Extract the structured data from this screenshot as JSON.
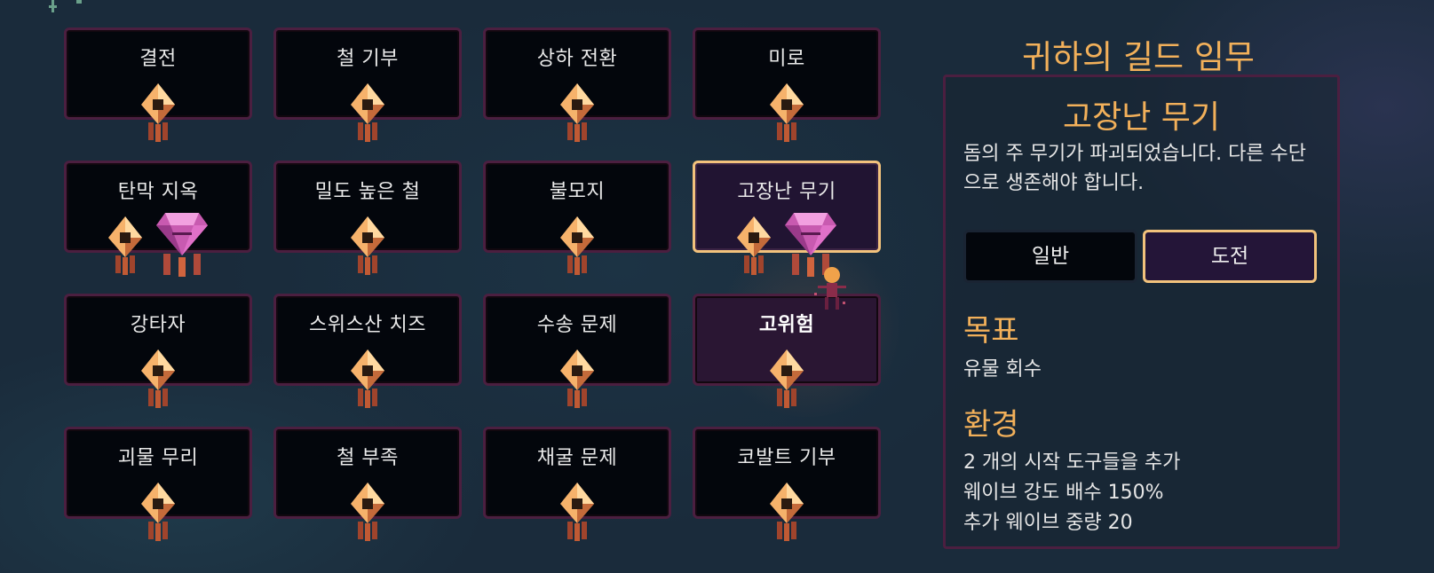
{
  "missions": [
    {
      "label": "결전",
      "gem": false
    },
    {
      "label": "철 기부",
      "gem": false
    },
    {
      "label": "상하 전환",
      "gem": false
    },
    {
      "label": "미로",
      "gem": false
    },
    {
      "label": "탄막 지옥",
      "gem": true
    },
    {
      "label": "밀도 높은 철",
      "gem": false
    },
    {
      "label": "불모지",
      "gem": false
    },
    {
      "label": "고장난 무기",
      "gem": true,
      "selected": true
    },
    {
      "label": "강타자",
      "gem": false
    },
    {
      "label": "스위스산 치즈",
      "gem": false
    },
    {
      "label": "수송 문제",
      "gem": false
    },
    {
      "label": "고위험",
      "gem": false,
      "hover": true
    },
    {
      "label": "괴물 무리",
      "gem": false
    },
    {
      "label": "철 부족",
      "gem": false
    },
    {
      "label": "채굴 문제",
      "gem": false
    },
    {
      "label": "코발트 기부",
      "gem": false
    }
  ],
  "panel": {
    "title": "귀하의 길드 임무",
    "mission_name": "고장난 무기",
    "description": "돔의 주 무기가 파괴되었습니다. 다른 수단으로 생존해야 합니다.",
    "mode_normal": "일반",
    "mode_challenge": "도전",
    "selected_mode": "도전",
    "objective_heading": "목표",
    "objective_text": "유물 회수",
    "environment_heading": "환경",
    "environment_lines": [
      "2 개의 시작 도구들을 추가",
      "웨이브 강도 배수 150%",
      "추가 웨이브 중량 20"
    ]
  },
  "colors": {
    "accent": "#f2b05a",
    "tile_border": "#4b1f40",
    "selected_border": "#f2c27c",
    "relic_gem": "#c85ab0"
  },
  "icons": {
    "reward": "amber-relic-icon",
    "bonus": "pink-gem-icon",
    "player": "keeper-character-icon"
  }
}
